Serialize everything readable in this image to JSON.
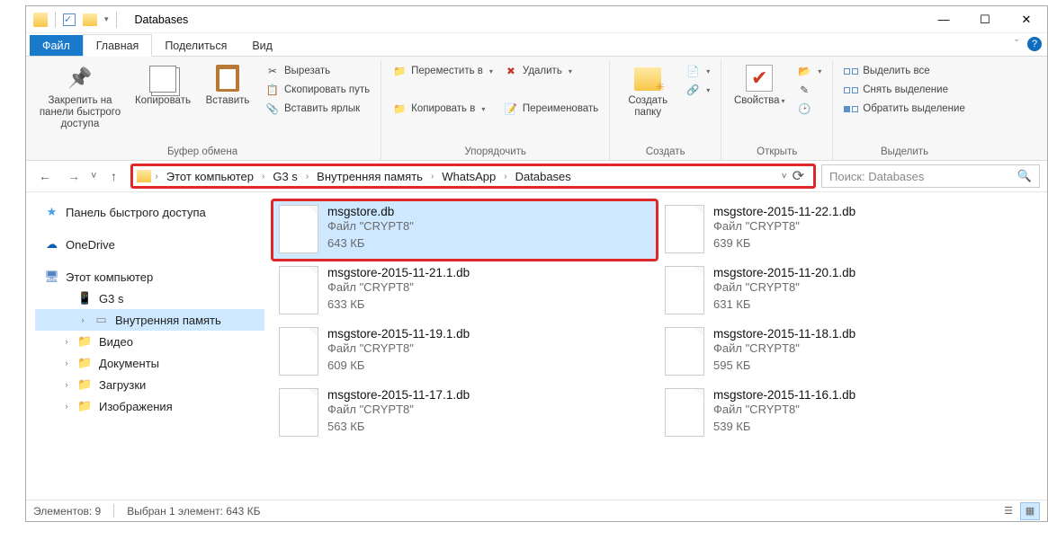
{
  "window": {
    "title": "Databases"
  },
  "tabs": {
    "file": "Файл",
    "home": "Главная",
    "share": "Поделиться",
    "view": "Вид"
  },
  "ribbon": {
    "pin": "Закрепить на панели быстрого доступа",
    "copy": "Копировать",
    "paste": "Вставить",
    "cut": "Вырезать",
    "copypath": "Скопировать путь",
    "pasteshortcut": "Вставить ярлык",
    "clipboard_group": "Буфер обмена",
    "moveto": "Переместить в",
    "copyto": "Копировать в",
    "delete": "Удалить",
    "rename": "Переименовать",
    "organize_group": "Упорядочить",
    "newfolder": "Создать папку",
    "new_group": "Создать",
    "properties": "Свойства",
    "open_group": "Открыть",
    "selectall": "Выделить все",
    "selectnone": "Снять выделение",
    "invert": "Обратить выделение",
    "select_group": "Выделить"
  },
  "breadcrumb": [
    "Этот компьютер",
    "G3 s",
    "Внутренняя память",
    "WhatsApp",
    "Databases"
  ],
  "search": {
    "placeholder": "Поиск: Databases"
  },
  "sidebar": {
    "quick": "Панель быстрого доступа",
    "onedrive": "OneDrive",
    "pc": "Этот компьютер",
    "device": "G3 s",
    "storage": "Внутренняя память",
    "videos": "Видео",
    "documents": "Документы",
    "downloads": "Загрузки",
    "pictures": "Изображения"
  },
  "files": [
    {
      "name": "msgstore.db",
      "type": "Файл \"CRYPT8\"",
      "size": "643 КБ",
      "selected": true
    },
    {
      "name": "msgstore-2015-11-22.1.db",
      "type": "Файл \"CRYPT8\"",
      "size": "639 КБ"
    },
    {
      "name": "msgstore-2015-11-21.1.db",
      "type": "Файл \"CRYPT8\"",
      "size": "633 КБ"
    },
    {
      "name": "msgstore-2015-11-20.1.db",
      "type": "Файл \"CRYPT8\"",
      "size": "631 КБ"
    },
    {
      "name": "msgstore-2015-11-19.1.db",
      "type": "Файл \"CRYPT8\"",
      "size": "609 КБ"
    },
    {
      "name": "msgstore-2015-11-18.1.db",
      "type": "Файл \"CRYPT8\"",
      "size": "595 КБ"
    },
    {
      "name": "msgstore-2015-11-17.1.db",
      "type": "Файл \"CRYPT8\"",
      "size": "563 КБ"
    },
    {
      "name": "msgstore-2015-11-16.1.db",
      "type": "Файл \"CRYPT8\"",
      "size": "539 КБ"
    }
  ],
  "status": {
    "count": "Элементов: 9",
    "selection": "Выбран 1 элемент: 643 КБ"
  }
}
